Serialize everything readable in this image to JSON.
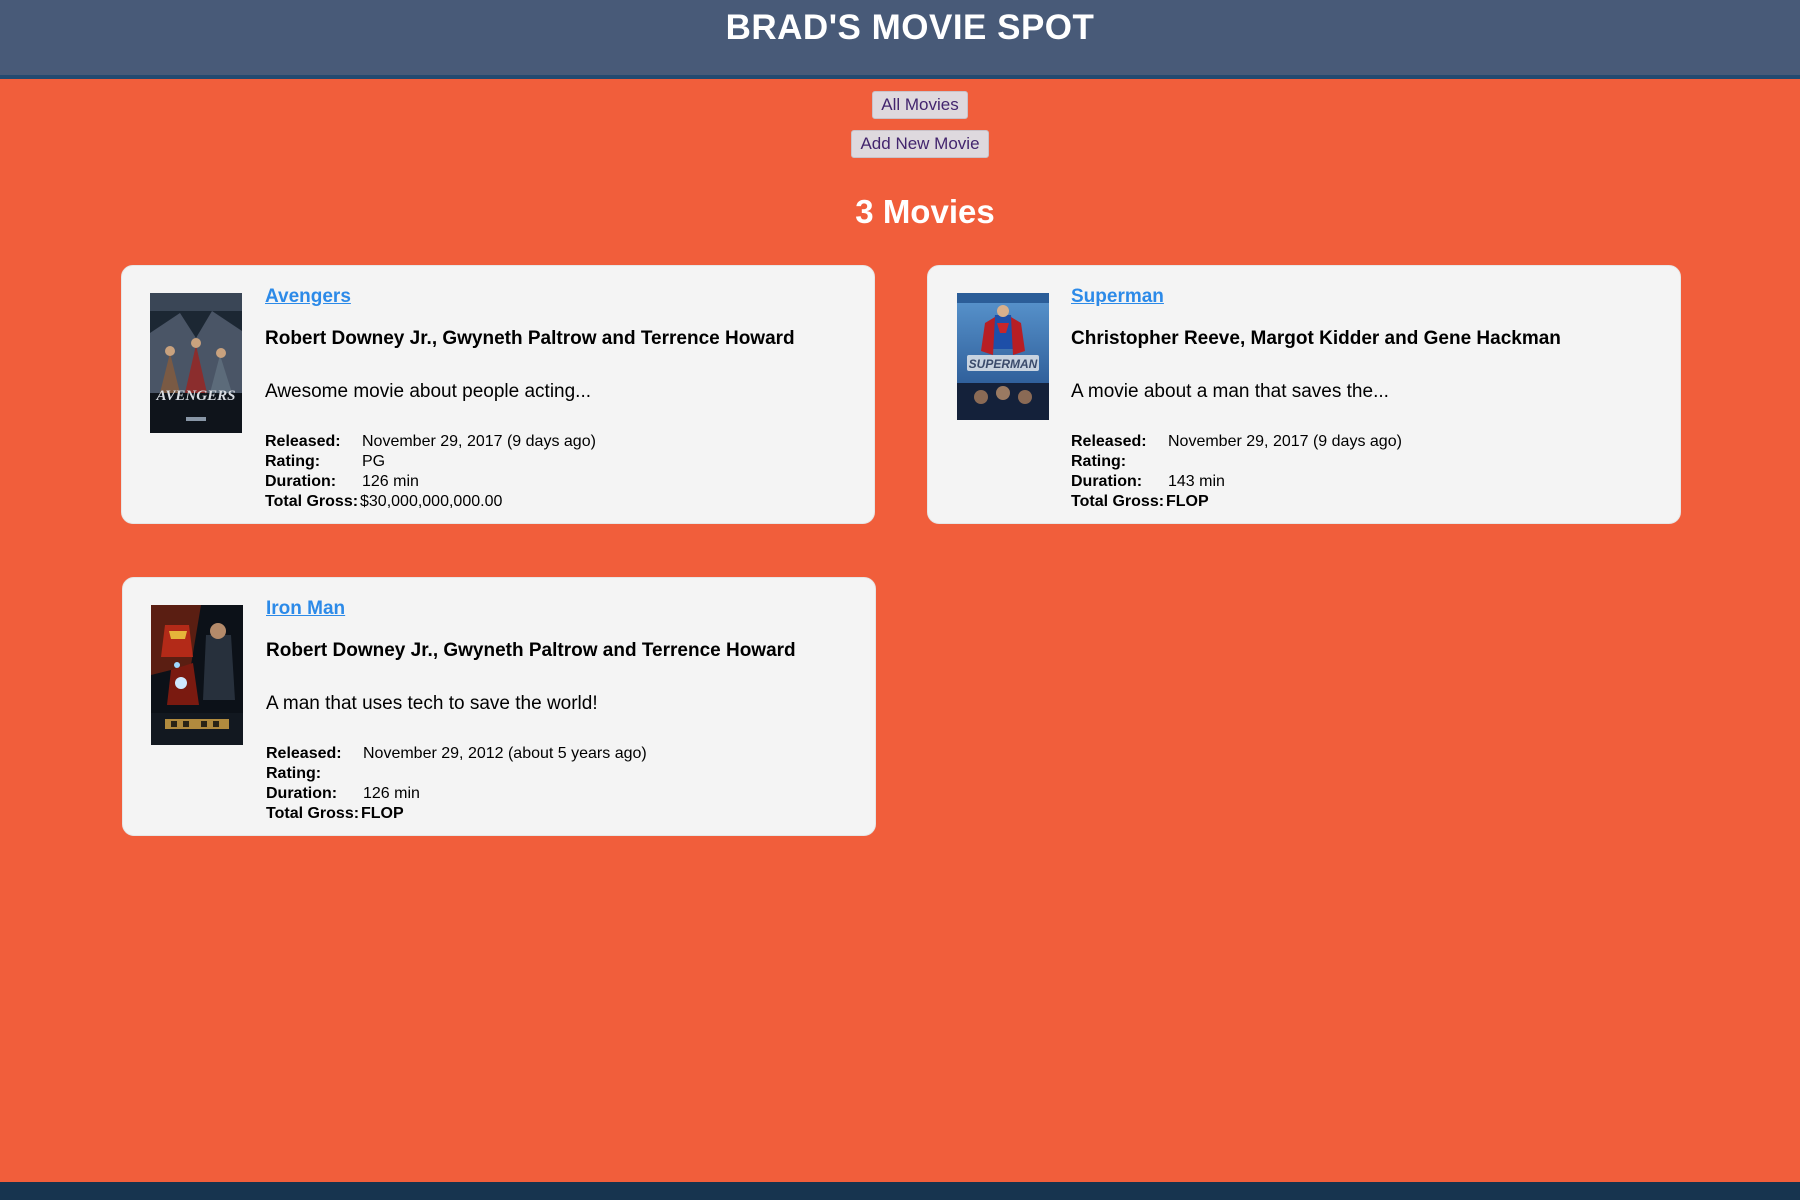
{
  "header": {
    "title": "BRAD'S MOVIE SPOT"
  },
  "nav": {
    "all_movies": "All Movies",
    "add_movie": "Add New Movie"
  },
  "count_label": "3 Movies",
  "labels": {
    "released": "Released:",
    "rating": "Rating:",
    "duration": "Duration:",
    "gross": "Total Gross:"
  },
  "movies": [
    {
      "title": "Avengers",
      "cast": "Robert Downey Jr., Gwyneth Paltrow and Terrence Howard",
      "description": "Awesome movie about people acting...",
      "released": "November 29, 2017 (9 days ago)",
      "rating": "PG",
      "duration": "126 min",
      "gross": "$30,000,000,000.00",
      "poster_icon": "avengers-poster"
    },
    {
      "title": "Superman",
      "cast": "Christopher Reeve, Margot Kidder and Gene Hackman",
      "description": "A movie about a man that saves the...",
      "released": "November 29, 2017 (9 days ago)",
      "rating": "",
      "duration": "143 min",
      "gross": "FLOP",
      "poster_icon": "superman-poster"
    },
    {
      "title": "Iron Man",
      "cast": "Robert Downey Jr., Gwyneth Paltrow and Terrence Howard",
      "description": "A man that uses tech to save the world!",
      "released": "November 29, 2012 (about 5 years ago)",
      "rating": "",
      "duration": "126 min",
      "gross": "FLOP",
      "poster_icon": "iron-man-poster"
    }
  ],
  "colors": {
    "page_background": "#f15e3b",
    "header_background": "#485a78",
    "card_background": "#f4f4f4",
    "link": "#2c8ae8",
    "footer": "#17344f"
  }
}
